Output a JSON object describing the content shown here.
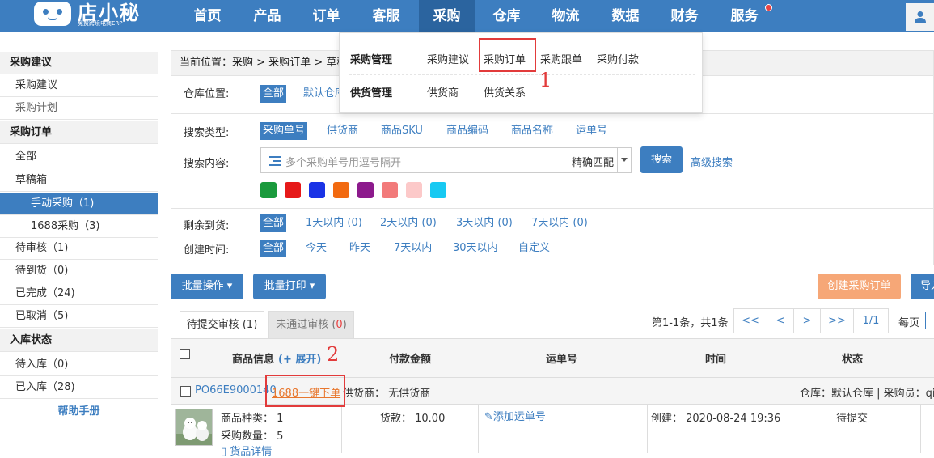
{
  "brand": {
    "name": "店小秘",
    "subtitle": "免费跨境电商ERP"
  },
  "nav": {
    "items": [
      "首页",
      "产品",
      "订单",
      "客服",
      "采购",
      "仓库",
      "物流",
      "数据",
      "财务",
      "服务"
    ],
    "active": "采购"
  },
  "dropdown": {
    "groups": [
      {
        "title": "采购管理",
        "items": [
          "采购建议",
          "采购订单",
          "采购跟单",
          "采购付款"
        ]
      },
      {
        "title": "供货管理",
        "items": [
          "供货商",
          "供货关系"
        ]
      }
    ]
  },
  "sidebar": {
    "rows": [
      {
        "label": "采购建议",
        "kind": "head"
      },
      {
        "label": "采购建议",
        "kind": "item"
      },
      {
        "label": "采购计划",
        "kind": "item-muted"
      },
      {
        "label": "采购订单",
        "kind": "head"
      },
      {
        "label": "全部",
        "kind": "item"
      },
      {
        "label": "草稿箱",
        "kind": "item"
      },
      {
        "label": "手动采购（1)",
        "kind": "sub-active"
      },
      {
        "label": "1688采购（3)",
        "kind": "sub"
      },
      {
        "label": "待审核（1)",
        "kind": "item"
      },
      {
        "label": "待到货（0)",
        "kind": "item"
      },
      {
        "label": "已完成（24)",
        "kind": "item"
      },
      {
        "label": "已取消（5)",
        "kind": "item"
      },
      {
        "label": "入库状态",
        "kind": "head"
      },
      {
        "label": "待入库（0)",
        "kind": "item"
      },
      {
        "label": "已入库（28)",
        "kind": "item"
      },
      {
        "label": "帮助手册",
        "kind": "help"
      }
    ]
  },
  "breadcrumb": "当前位置：采购 > 采购订单 > 草稿",
  "filters": {
    "warehouse": {
      "label": "仓库位置:",
      "options": [
        "全部",
        "默认仓库"
      ]
    },
    "search_type": {
      "label": "搜索类型:",
      "options": [
        "采购单号",
        "供货商",
        "商品SKU",
        "商品编码",
        "商品名称",
        "运单号"
      ]
    },
    "search_content": {
      "label": "搜索内容:",
      "placeholder": "多个采购单号用逗号隔开",
      "match_mode": "精确匹配",
      "search_button": "搜索",
      "advanced": "高级搜索"
    },
    "color_tags": [
      "#1a9a3c",
      "#e61919",
      "#1a33e6",
      "#f26a10",
      "#8c1a8c",
      "#f27a7a",
      "#fcc9c9",
      "#17c9f2"
    ],
    "remaining": {
      "label": "剩余到货:",
      "options": [
        "全部",
        "1天以内 (0)",
        "2天以内 (0)",
        "3天以内 (0)",
        "7天以内 (0)"
      ]
    },
    "created": {
      "label": "创建时间:",
      "options": [
        "全部",
        "今天",
        "昨天",
        "7天以内",
        "30天以内",
        "自定义"
      ]
    }
  },
  "toolbar": {
    "batch_ops": "批量操作 ▾",
    "batch_print": "批量打印 ▾",
    "create_order": "创建采购订单",
    "import": "导入"
  },
  "tabs": [
    {
      "label": "待提交审核 (1)"
    },
    {
      "label": "未通过审核 (",
      "count": "0",
      "close": ")"
    }
  ],
  "pager": {
    "summary": "第1-1条，共1条",
    "buttons": [
      "<<",
      "<",
      ">",
      ">>",
      "1/1"
    ],
    "per_page": "每页"
  },
  "table": {
    "headers": {
      "product": "商品信息",
      "expand": "(+ 展开)",
      "amount": "付款金额",
      "tracking": "运单号",
      "time": "时间",
      "status": "状态"
    },
    "order": {
      "id": "PO66E9000140",
      "one_click": "1688一键下单",
      "supplier": "供货商： 无供货商",
      "warehouse_info": "仓库：默认仓库 | 采购员：qia",
      "kinds": "商品种类： 1",
      "qty": "采购数量： 5",
      "detail": "货品详情",
      "payment": "货款：  10.00",
      "add_tracking": "添加运单号",
      "created": "创建：  2020-08-24 19:36",
      "status": "待提交"
    }
  },
  "annotations": {
    "one": "1",
    "two": "2"
  }
}
